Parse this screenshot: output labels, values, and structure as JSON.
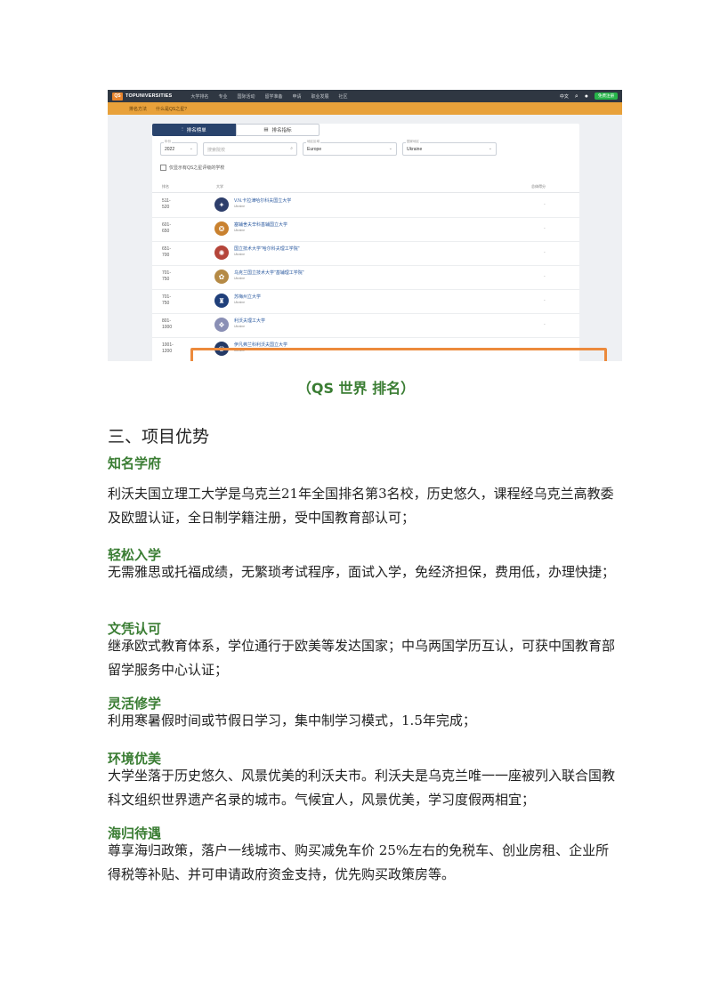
{
  "screenshot": {
    "logo_badge": "QS",
    "logo_text": "TOPUNIVERSITIES",
    "nav": [
      "大学排名",
      "专业",
      "国际活动",
      "留学准备",
      "申请",
      "职业发展",
      "社区"
    ],
    "lang": "中文",
    "signup": "免费注册",
    "subnav": [
      "排名方法",
      "什么是QS之星?"
    ],
    "tabs": {
      "ranking": "排名榜单",
      "indicators": "排名指标"
    },
    "filters": {
      "year": {
        "label": "年份",
        "value": "2022"
      },
      "search": {
        "placeholder": "搜索院校"
      },
      "region": {
        "label": "地区区域",
        "value": "Europe"
      },
      "country": {
        "label": "国家地区",
        "value": "Ukraine"
      }
    },
    "checkbox_label": "仅显示有QS之星评级的学校",
    "table_headers": {
      "rank": "排名",
      "university": "大学",
      "overall": "总体得分"
    },
    "rows": [
      {
        "rank": "511-\n520",
        "name": "V.N.卡拉津哈尔科夫国立大学",
        "country": "Ukraine",
        "score": "-",
        "crest_color": "#2d3e6b",
        "crest_glyph": "✦"
      },
      {
        "rank": "601-\n650",
        "name": "塞辅舍夫辛科基辅国立大学",
        "country": "Ukraine",
        "score": "-",
        "crest_color": "#c9812f",
        "crest_glyph": "❂"
      },
      {
        "rank": "651-\n700",
        "name": "国立技术大学\"哈尔科夫理工学院\"",
        "country": "Ukraine",
        "score": "-",
        "crest_color": "#b5453a",
        "crest_glyph": "✺"
      },
      {
        "rank": "701-\n750",
        "name": "乌克兰国立技术大学\"基辅理工学院\"",
        "country": "Ukraine",
        "score": "-",
        "crest_color": "#b58a45",
        "crest_glyph": "✿"
      },
      {
        "rank": "701-\n750",
        "name": "苏梅州立大学",
        "country": "Ukraine",
        "score": "-",
        "crest_color": "#1f3f7a",
        "crest_glyph": "♜"
      },
      {
        "rank": "801-\n1000",
        "name": "利沃夫理工大学",
        "country": "Ukraine",
        "score": "-",
        "crest_color": "#8a8fb5",
        "crest_glyph": "❖"
      },
      {
        "rank": "1001-\n1200",
        "name": "伊凡弗兰科利沃夫国立大学",
        "country": "Ukraine",
        "score": "-",
        "crest_color": "#243a66",
        "crest_glyph": "♛"
      }
    ]
  },
  "caption": "（QS 世界 排名）",
  "heading": "三、项目优势",
  "sections": [
    {
      "title": "知名学府",
      "text": "利沃夫国立理工大学是乌克兰21年全国排名第3名校，历史悠久，课程经乌克兰高教委及欧盟认证，全日制学籍注册，受中国教育部认可；"
    },
    {
      "title": "轻松入学",
      "text": "无需雅思或托福成绩，无繁琐考试程序，面试入学，免经济担保，费用低，办理快捷；"
    },
    {
      "title": "文凭认可",
      "text": "继承欧式教育体系，学位通行于欧美等发达国家；中乌两国学历互认，可获中国教育部留学服务中心认证；"
    },
    {
      "title": "灵活修学",
      "text": "利用寒暑假时间或节假日学习，集中制学习模式，1.5年完成；"
    },
    {
      "title": "环境优美",
      "text": "大学坐落于历史悠久、风景优美的利沃夫市。利沃夫是乌克兰唯一一座被列入联合国教科文组织世界遗产名录的城市。气候宜人，风景优美，学习度假两相宜；"
    },
    {
      "title": "海归待遇",
      "text": "尊享海归政策，落户一线城市、购买减免车价 25%左右的免税车、创业房租、企业所得税等补贴、并可申请政府资金支持，优先购买政策房等。"
    }
  ]
}
